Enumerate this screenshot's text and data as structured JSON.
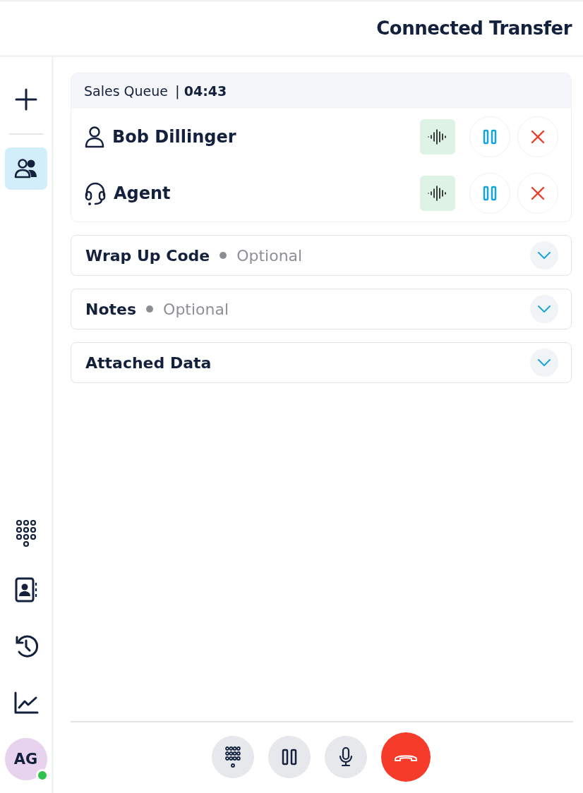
{
  "header": {
    "title": "Connected Transfer"
  },
  "sidebar": {
    "top_items": [
      {
        "kind": "add",
        "selected": false
      },
      {
        "kind": "participants",
        "selected": true
      }
    ],
    "bottom_items": [
      {
        "kind": "dialpad",
        "selected": false
      },
      {
        "kind": "contacts",
        "selected": false
      },
      {
        "kind": "history",
        "selected": false
      },
      {
        "kind": "stats",
        "selected": false
      }
    ],
    "avatar": {
      "initials": "AG",
      "online": true
    }
  },
  "call": {
    "queue": "Sales Queue",
    "separator": "|",
    "timer": "04:43",
    "participants": [
      {
        "kind": "person",
        "name": "Bob Dillinger"
      },
      {
        "kind": "agent",
        "name": "Agent"
      }
    ]
  },
  "sections": [
    {
      "title": "Wrap Up Code",
      "hint": "Optional",
      "expanded": false
    },
    {
      "title": "Notes",
      "hint": "Optional",
      "expanded": false
    },
    {
      "title": "Attached Data",
      "expanded": false
    }
  ],
  "controls": [
    {
      "kind": "dialpad"
    },
    {
      "kind": "hold"
    },
    {
      "kind": "mic"
    },
    {
      "kind": "hangup"
    }
  ]
}
